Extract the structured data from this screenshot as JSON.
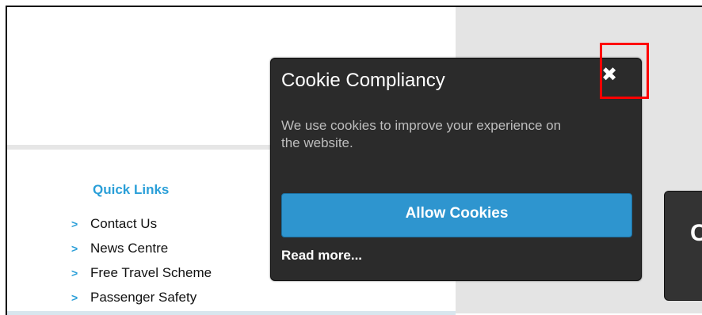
{
  "quick_links": {
    "title": "Quick Links",
    "items": [
      {
        "label": "Contact Us"
      },
      {
        "label": "News Centre"
      },
      {
        "label": "Free Travel Scheme"
      },
      {
        "label": "Passenger Safety"
      }
    ],
    "arrow_glyph": ">"
  },
  "side_button": {
    "label": "C"
  },
  "cookie_popup": {
    "title": "Cookie Compliancy",
    "message": "We use cookies to improve your experience on the website.",
    "close_glyph": "✖",
    "allow_label": "Allow Cookies",
    "read_more_label": "Read more..."
  },
  "colors": {
    "accent": "#2a9fd8",
    "popup_bg": "#2b2b2b",
    "allow_button": "#2e95cf",
    "highlight": "#ff0000"
  }
}
